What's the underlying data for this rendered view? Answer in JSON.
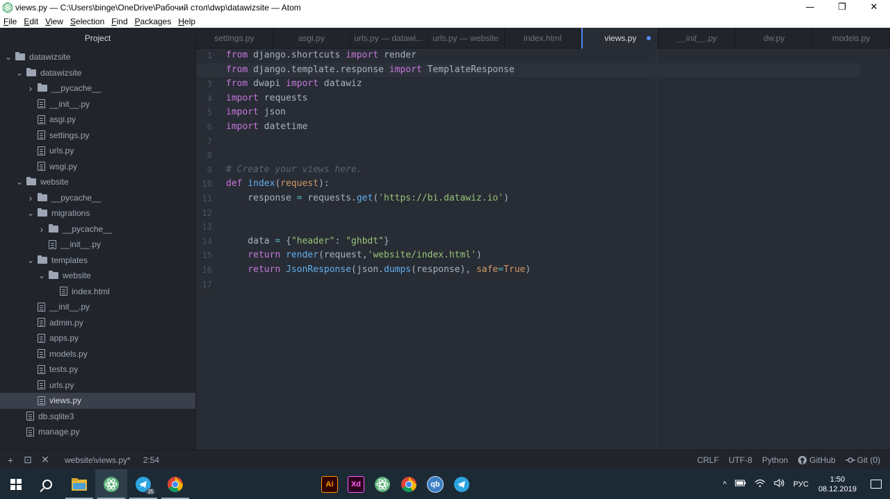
{
  "window": {
    "title": "views.py — C:\\Users\\binge\\OneDrive\\Рабочий стол\\dwp\\datawizsite — Atom",
    "minimize_glyph": "—",
    "maximize_glyph": "❐",
    "close_glyph": "✕"
  },
  "menu": [
    {
      "underline": "F",
      "rest": "ile"
    },
    {
      "underline": "E",
      "rest": "dit"
    },
    {
      "underline": "V",
      "rest": "iew"
    },
    {
      "underline": "S",
      "rest": "election"
    },
    {
      "underline": "F",
      "rest": "ind"
    },
    {
      "underline": "P",
      "rest": "ackages"
    },
    {
      "underline": "H",
      "rest": "elp"
    }
  ],
  "sidebar": {
    "title": "Project",
    "tree": [
      {
        "label": "datawizsite",
        "type": "folder",
        "depth": 0,
        "expanded": true
      },
      {
        "label": "datawizsite",
        "type": "folder",
        "depth": 1,
        "expanded": true
      },
      {
        "label": "__pycache__",
        "type": "folder",
        "depth": 2,
        "expanded": false
      },
      {
        "label": "__init__.py",
        "type": "file",
        "depth": 2
      },
      {
        "label": "asgi.py",
        "type": "file",
        "depth": 2
      },
      {
        "label": "settings.py",
        "type": "file",
        "depth": 2
      },
      {
        "label": "urls.py",
        "type": "file",
        "depth": 2
      },
      {
        "label": "wsgi.py",
        "type": "file",
        "depth": 2
      },
      {
        "label": "website",
        "type": "folder",
        "depth": 1,
        "expanded": true
      },
      {
        "label": "__pycache__",
        "type": "folder",
        "depth": 2,
        "expanded": false
      },
      {
        "label": "migrations",
        "type": "folder",
        "depth": 2,
        "expanded": true
      },
      {
        "label": "__pycache__",
        "type": "folder",
        "depth": 3,
        "expanded": false
      },
      {
        "label": "__init__.py",
        "type": "file",
        "depth": 3
      },
      {
        "label": "templates",
        "type": "folder",
        "depth": 2,
        "expanded": true
      },
      {
        "label": "website",
        "type": "folder",
        "depth": 3,
        "expanded": true
      },
      {
        "label": "index.html",
        "type": "file",
        "depth": 4
      },
      {
        "label": "__init__.py",
        "type": "file",
        "depth": 2
      },
      {
        "label": "admin.py",
        "type": "file",
        "depth": 2
      },
      {
        "label": "apps.py",
        "type": "file",
        "depth": 2
      },
      {
        "label": "models.py",
        "type": "file",
        "depth": 2
      },
      {
        "label": "tests.py",
        "type": "file",
        "depth": 2
      },
      {
        "label": "urls.py",
        "type": "file",
        "depth": 2
      },
      {
        "label": "views.py",
        "type": "file",
        "depth": 2,
        "selected": true
      },
      {
        "label": "db.sqlite3",
        "type": "file",
        "depth": 1
      },
      {
        "label": "manage.py",
        "type": "file",
        "depth": 1
      }
    ]
  },
  "tabs": [
    {
      "label": "settings.py"
    },
    {
      "label": "asgi.py"
    },
    {
      "label": "urls.py — datawi..."
    },
    {
      "label": "urls.py — website"
    },
    {
      "label": "index.html"
    },
    {
      "label": "views.py",
      "active": true,
      "modified": true
    },
    {
      "label": "__init__.py",
      "italic": true
    },
    {
      "label": "dw.py"
    },
    {
      "label": "models.py"
    }
  ],
  "editor": {
    "current_line": 2,
    "lines": [
      [
        [
          "k",
          "from"
        ],
        [
          "t",
          " django.shortcuts "
        ],
        [
          "k",
          "import"
        ],
        [
          "t",
          " render"
        ]
      ],
      [
        [
          "k",
          "from"
        ],
        [
          "t",
          " django.template.response "
        ],
        [
          "k",
          "import"
        ],
        [
          "t",
          " TemplateResponse"
        ]
      ],
      [
        [
          "k",
          "from"
        ],
        [
          "t",
          " dwapi "
        ],
        [
          "k",
          "import"
        ],
        [
          "t",
          " datawiz"
        ]
      ],
      [
        [
          "k",
          "import"
        ],
        [
          "t",
          " requests"
        ]
      ],
      [
        [
          "k",
          "import"
        ],
        [
          "t",
          " json"
        ]
      ],
      [
        [
          "k",
          "import"
        ],
        [
          "t",
          " datetime"
        ]
      ],
      [],
      [],
      [
        [
          "c",
          "# Create your views here."
        ]
      ],
      [
        [
          "k",
          "def"
        ],
        [
          "t",
          " "
        ],
        [
          "f",
          "index"
        ],
        [
          "t",
          "("
        ],
        [
          "a",
          "request"
        ],
        [
          "t",
          "):"
        ]
      ],
      [
        [
          "t",
          "    response "
        ],
        [
          "o",
          "="
        ],
        [
          "t",
          " requests."
        ],
        [
          "f",
          "get"
        ],
        [
          "t",
          "("
        ],
        [
          "s",
          "'https://bi.datawiz.io'"
        ],
        [
          "t",
          ")"
        ]
      ],
      [],
      [],
      [
        [
          "t",
          "    data "
        ],
        [
          "o",
          "="
        ],
        [
          "t",
          " {"
        ],
        [
          "s",
          "\"header\""
        ],
        [
          "t",
          ": "
        ],
        [
          "s",
          "\"ghbdt\""
        ],
        [
          "t",
          "}"
        ]
      ],
      [
        [
          "t",
          "    "
        ],
        [
          "k",
          "return"
        ],
        [
          "t",
          " "
        ],
        [
          "f",
          "render"
        ],
        [
          "t",
          "(request,"
        ],
        [
          "s",
          "'website/index.html'"
        ],
        [
          "t",
          ")"
        ]
      ],
      [
        [
          "t",
          "    "
        ],
        [
          "k",
          "return"
        ],
        [
          "t",
          " "
        ],
        [
          "f",
          "JsonResponse"
        ],
        [
          "t",
          "(json."
        ],
        [
          "f",
          "dumps"
        ],
        [
          "t",
          "(response), "
        ],
        [
          "a",
          "safe"
        ],
        [
          "o",
          "="
        ],
        [
          "a",
          "True"
        ],
        [
          "t",
          ")"
        ]
      ],
      []
    ]
  },
  "statusbar": {
    "add_glyph": "+",
    "terminal_glyph": "⊡",
    "close_glyph": "✕",
    "file": "website\\views.py*",
    "cursor": "2:54",
    "line_ending": "CRLF",
    "encoding": "UTF-8",
    "grammar": "Python",
    "github": "GitHub",
    "git": "Git (0)"
  },
  "taskbar": {
    "telegram_badge": "35",
    "ai_label": "Ai",
    "xd_label": "Xd",
    "qb_label": "qb",
    "tray_lang": "РУС",
    "tray_chevron": "^",
    "time": "1:50",
    "date": "08.12.2019"
  },
  "colors": {
    "accent": "#568af2",
    "keyword": "#c678dd",
    "function": "#61afef",
    "string": "#98c379",
    "comment": "#5c6370"
  }
}
